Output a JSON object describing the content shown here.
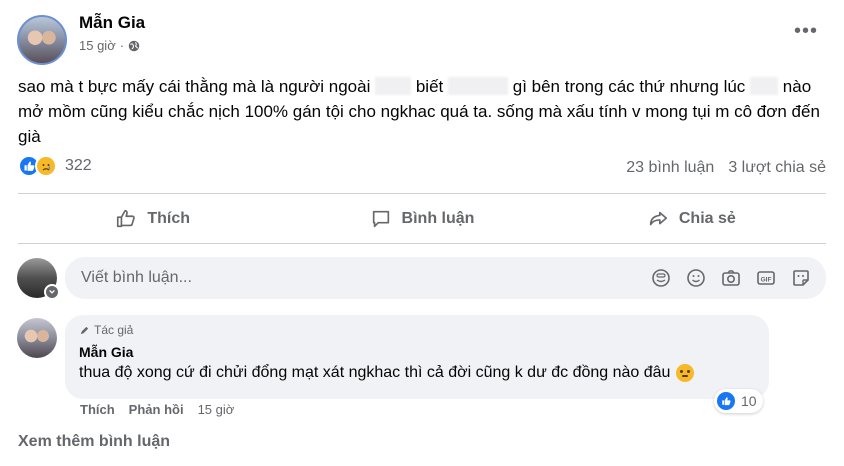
{
  "post": {
    "author_name": "Mẫn Gia",
    "time": "15 giờ",
    "privacy_icon": "globe-icon",
    "text_parts": [
      "sao mà t bực mấy cái thằng mà là người ngoài",
      "biết",
      "gì bên trong các  thứ nhưng lúc",
      "nào mở mồm cũng kiểu chắc nịch 100% gán tội cho ngkhac quá ta. sống mà xấu tính v mong tụi m cô đơn đến già"
    ],
    "reaction_count": "322",
    "comments_count": "23 bình luận",
    "shares_count": "3 lượt chia sẻ"
  },
  "actions": {
    "like": "Thích",
    "comment": "Bình luận",
    "share": "Chia sẻ"
  },
  "composer": {
    "placeholder": "Viết bình luận..."
  },
  "comment": {
    "badge": "Tác giả",
    "author": "Mẫn Gia",
    "text": "thua độ xong cứ đi chửi đổng mạt xát ngkhac thì cả đời cũng k dư đc đồng nào đâu",
    "reaction_count": "10",
    "like": "Thích",
    "reply": "Phản hồi",
    "time": "15 giờ"
  },
  "see_more": "Xem thêm bình luận",
  "colors": {
    "like_blue": "#1877f2",
    "sad_yellow": "#f7b928",
    "secondary_text": "#65676b",
    "bubble_bg": "#f0f2f5"
  }
}
